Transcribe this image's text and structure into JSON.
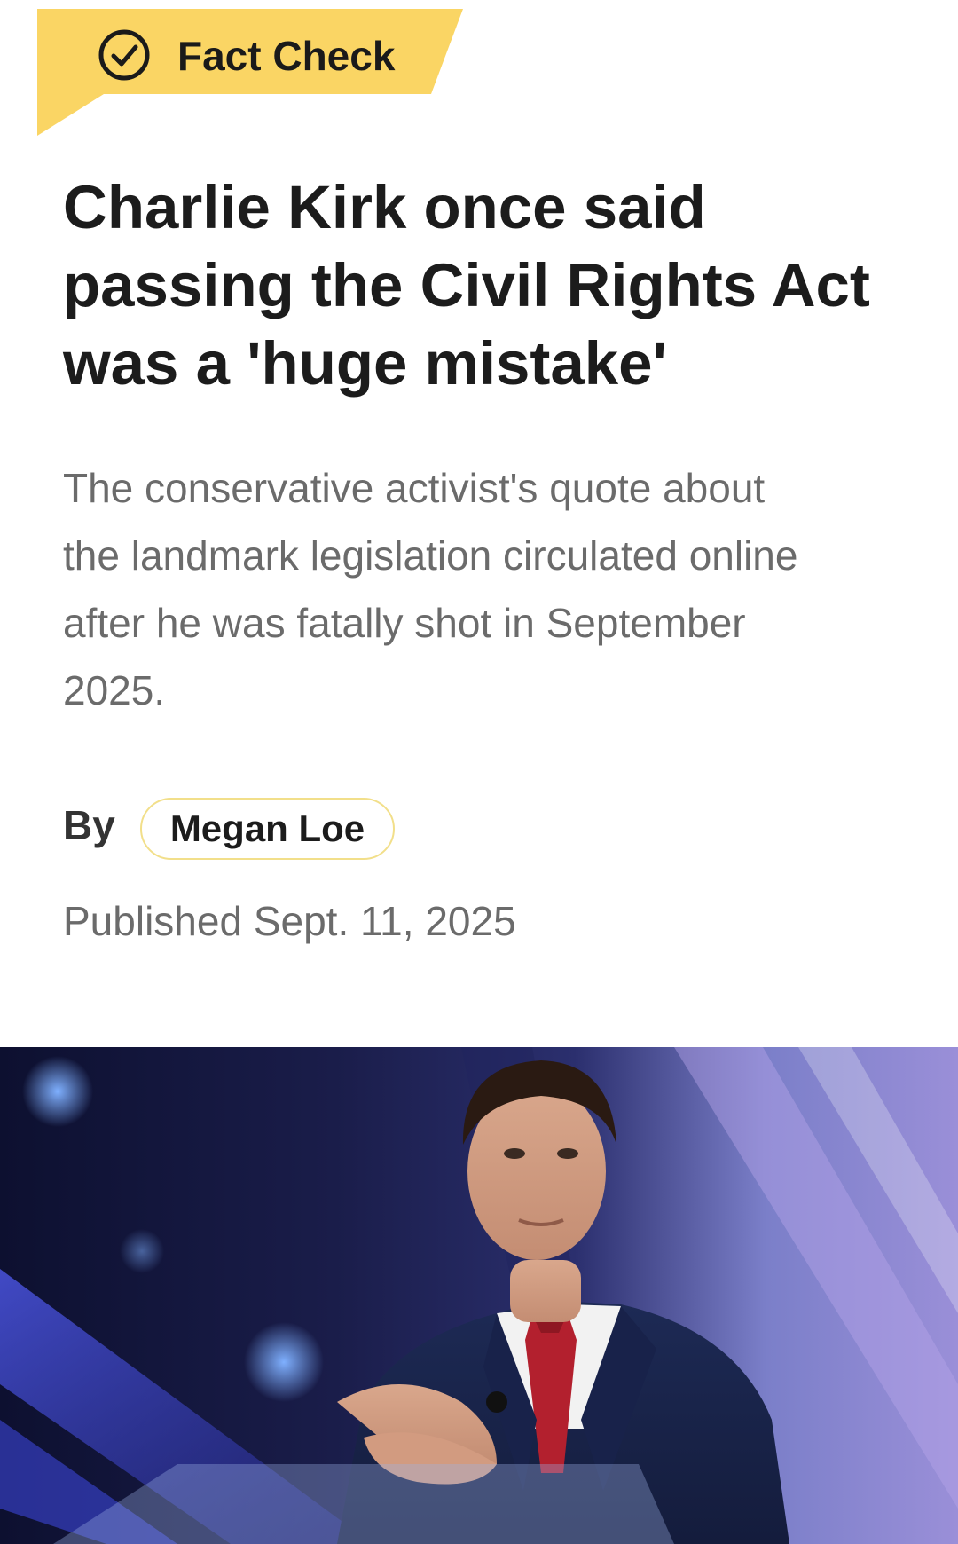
{
  "badge": {
    "icon": "check-circle-icon",
    "label": "Fact Check",
    "color": "#FAD564"
  },
  "article": {
    "headline_lines": [
      "Charlie Kirk once said",
      "passing the Civil Rights Act",
      "was a 'huge mistake'"
    ],
    "dek_lines": [
      "The conservative activist's quote about",
      "the landmark legislation circulated online",
      "after he was fatally shot in September",
      "2025."
    ],
    "by_label": "By",
    "author": "Megan Loe",
    "published": "Published Sept. 11, 2025"
  },
  "photo": {
    "subject": "man in navy suit with red tie clapping at a podium on stage with blue and purple lights"
  }
}
